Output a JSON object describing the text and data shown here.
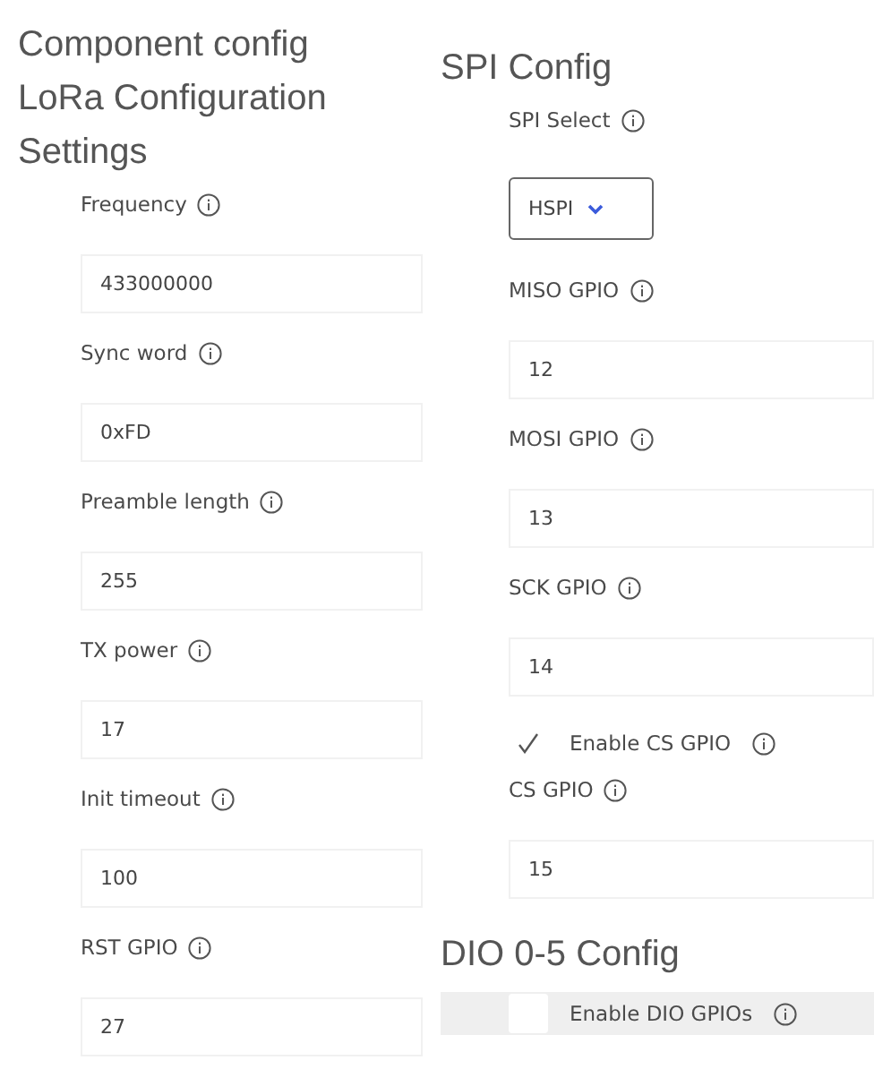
{
  "left": {
    "headings": [
      "Component config",
      "LoRa Configuration",
      "Settings"
    ],
    "items": [
      {
        "kind": "input",
        "label": "Frequency",
        "value": "433000000"
      },
      {
        "kind": "input",
        "label": "Sync word",
        "value": "0xFD"
      },
      {
        "kind": "input",
        "label": "Preamble length",
        "value": "255"
      },
      {
        "kind": "input",
        "label": "TX power",
        "value": "17"
      },
      {
        "kind": "input",
        "label": "Init timeout",
        "value": "100"
      },
      {
        "kind": "input",
        "label": "RST GPIO",
        "value": "27"
      }
    ]
  },
  "right": {
    "sections": [
      {
        "heading": "SPI Config",
        "items": [
          {
            "kind": "select",
            "label": "SPI Select",
            "value": "HSPI"
          },
          {
            "kind": "input",
            "label": "MISO GPIO",
            "value": "12"
          },
          {
            "kind": "input",
            "label": "MOSI GPIO",
            "value": "13"
          },
          {
            "kind": "input",
            "label": "SCK GPIO",
            "value": "14"
          },
          {
            "kind": "checkbox",
            "label": "Enable CS GPIO",
            "checked": true,
            "highlighted": false
          },
          {
            "kind": "input",
            "label": "CS GPIO",
            "value": "15"
          }
        ]
      },
      {
        "heading": "DIO 0-5 Config",
        "items": [
          {
            "kind": "checkbox",
            "label": "Enable DIO GPIOs",
            "checked": false,
            "highlighted": true
          }
        ]
      }
    ]
  }
}
